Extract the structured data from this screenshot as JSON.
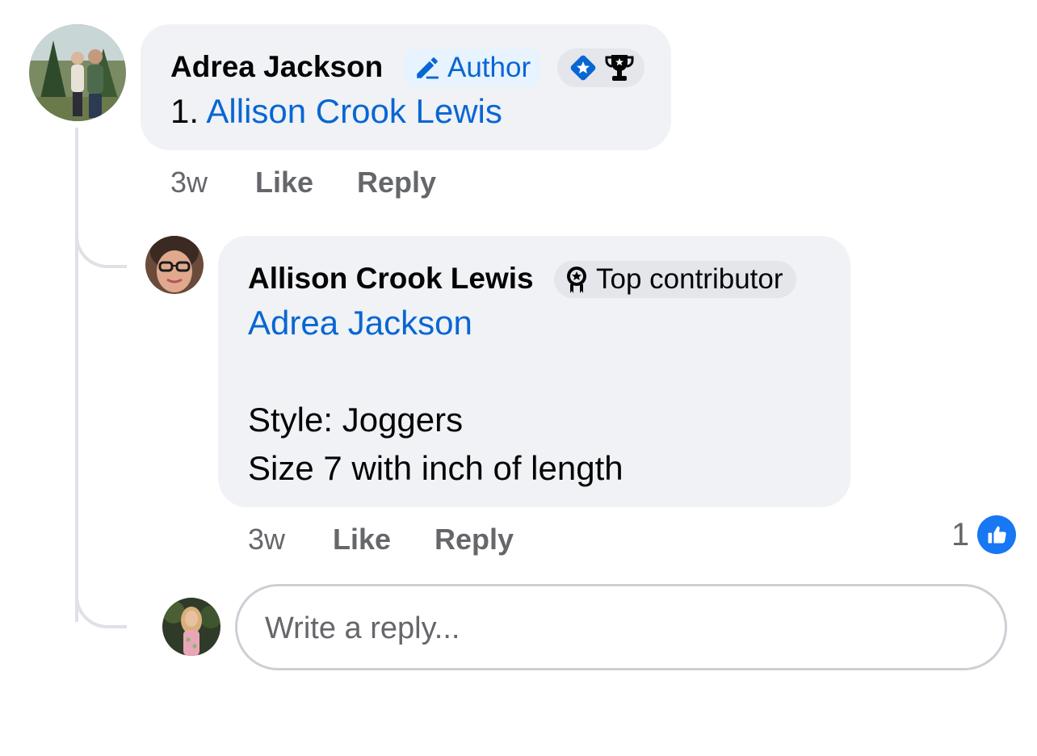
{
  "comment": {
    "author": "Adrea Jackson",
    "author_badge": "Author",
    "author_badge_icon": "pencil-icon",
    "extra_badges": [
      "diamond-star-icon",
      "trophy-icon"
    ],
    "number": "1.",
    "mention": "Allison Crook Lewis",
    "time": "3w",
    "like_label": "Like",
    "reply_label": "Reply"
  },
  "reply": {
    "author": "Allison Crook Lewis",
    "badge": "Top contributor",
    "badge_icon": "contributor-medal-icon",
    "mention": "Adrea Jackson",
    "lines": [
      "Style: Joggers",
      "Size 7 with inch of length"
    ],
    "time": "3w",
    "like_label": "Like",
    "reply_label": "Reply",
    "reaction_count": "1",
    "reaction_icon": "thumbs-up-icon"
  },
  "composer": {
    "placeholder": "Write a reply..."
  },
  "colors": {
    "bubble": "#f0f2f5",
    "link": "#0866d4",
    "like_blue": "#1877f2",
    "meta": "#65676b"
  }
}
